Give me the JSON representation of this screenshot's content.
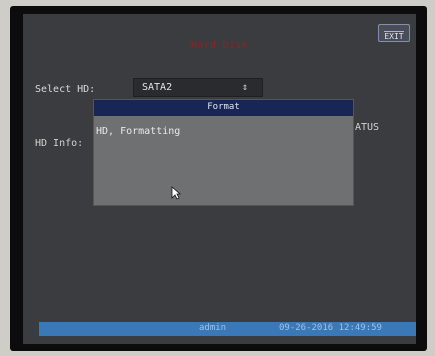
{
  "screen": {
    "title": "Hard Disk",
    "exit_label": "EXIT",
    "select_hd_label": "Select HD:",
    "selected_hd": "SATA2",
    "hd_info_label": "HD Info:",
    "status_label": "ATUS"
  },
  "dialog": {
    "title": "Format",
    "message": "HD, Formatting"
  },
  "status_bar": {
    "user": "admin",
    "datetime": "09-26-2016 12:49:59"
  },
  "icons": {
    "select_arrow": "up-down-arrow-icon",
    "cursor": "mouse-pointer-icon",
    "exit": "exit-icon"
  }
}
